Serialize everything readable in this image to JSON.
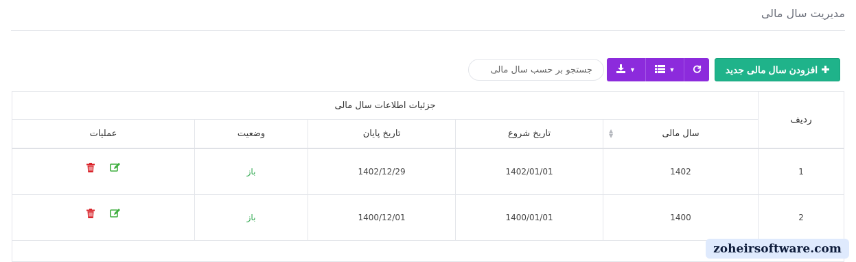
{
  "page": {
    "title": "مدیریت سال مالی"
  },
  "toolbar": {
    "add_label": "افزودن سال مالی جدید",
    "add_icon": "plus-icon",
    "refresh_icon": "refresh-icon",
    "columns_icon": "list-icon",
    "export_icon": "download-icon",
    "dropdown_icon": "caret-down-icon",
    "accent_green": "#1fb38a",
    "accent_purple": "#8c2bdc"
  },
  "search": {
    "placeholder": "جستجو بر حسب سال مالی",
    "value": ""
  },
  "table": {
    "rownum_header": "ردیف",
    "group_header": "جزئیات اطلاعات سال مالی",
    "columns": [
      "سال مالی",
      "تاریخ شروع",
      "تاریخ پایان",
      "وضعیت",
      "عملیات"
    ],
    "rows": [
      {
        "num": "1",
        "year": "1402",
        "start": "1402/01/01",
        "end": "1402/12/29",
        "status": "باز"
      },
      {
        "num": "2",
        "year": "1400",
        "start": "1400/01/01",
        "end": "1400/12/01",
        "status": "باز"
      }
    ],
    "edit_icon": "edit-icon",
    "delete_icon": "trash-icon",
    "status_color": "#2fa84f"
  },
  "watermark": {
    "text": "zoheirsoftware.com"
  }
}
